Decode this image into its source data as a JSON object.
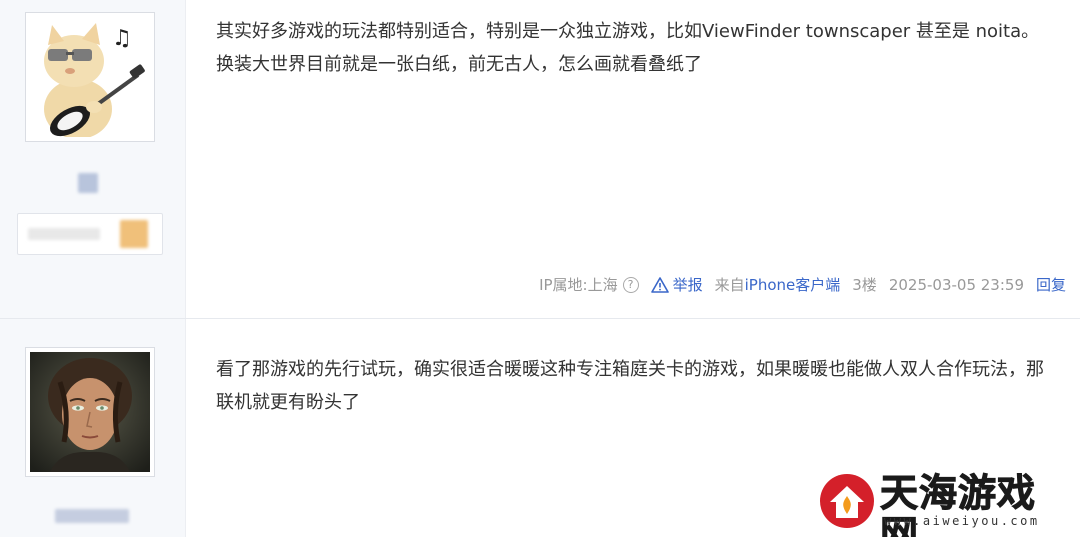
{
  "posts": [
    {
      "avatar": "cat-sunglasses-guitar-avatar",
      "content": "其实好多游戏的玩法都特别适合，特别是一众独立游戏，比如ViewFinder townscaper 甚至是 noita。换装大世界目前就是一张白纸，前无古人，怎么画就看叠纸了",
      "meta": {
        "ip": "IP属地:上海",
        "report": "举报",
        "source_prefix": "来自",
        "source_link": "iPhone客户端",
        "floor": "3楼",
        "time": "2025-03-05 23:59",
        "reply": "回复"
      }
    },
    {
      "avatar": "painted-portrait-avatar",
      "content": "看了那游戏的先行试玩，确实很适合暖暖这种专注箱庭关卡的游戏，如果暖暖也能做人双人合作玩法，那联机就更有盼头了"
    }
  ],
  "watermark": {
    "title": "天海游戏网",
    "url": "www.aiweiyou.com"
  },
  "colors": {
    "link": "#3a67c9",
    "sidebar_bg": "#f6f8fb",
    "text": "#333333",
    "meta": "#999999",
    "watermark_red": "#d4202a"
  }
}
